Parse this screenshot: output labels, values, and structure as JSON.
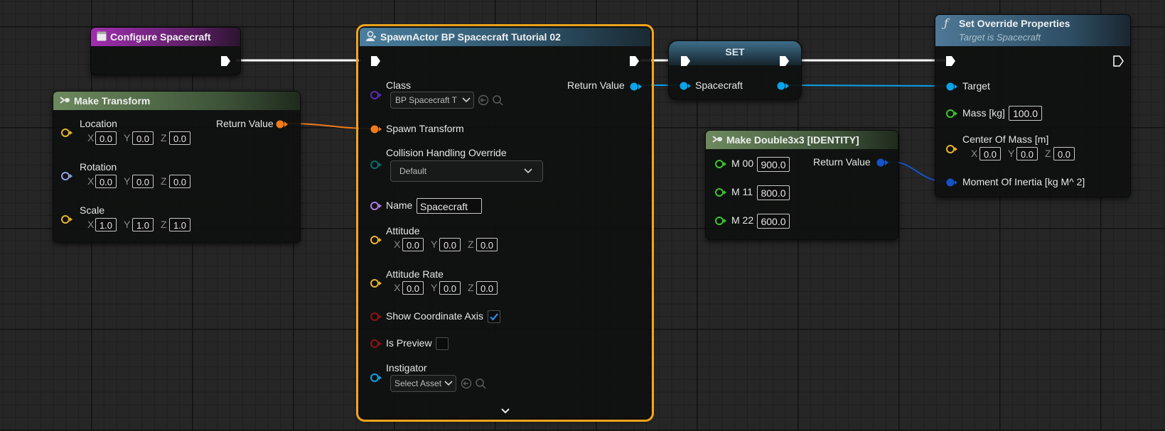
{
  "colors": {
    "exec": "#ffffff",
    "struct": "#e8b32b",
    "vector": "#8ea3e3",
    "transform": "#f07b1a",
    "object": "#0aa2e8",
    "class": "#5a2ab5",
    "enum": "#0a6a6a",
    "string": "#b07be0",
    "bool": "#8c1414",
    "double": "#3ac62c",
    "user_struct": "#1453c8",
    "selection": "#f3a41c"
  },
  "configure": {
    "title": "Configure Spacecraft"
  },
  "make_transform": {
    "title": "Make Transform",
    "return_label": "Return Value",
    "location_label": "Location",
    "rotation_label": "Rotation",
    "scale_label": "Scale",
    "axis_x": "X",
    "axis_y": "Y",
    "axis_z": "Z",
    "location": [
      "0.0",
      "0.0",
      "0.0"
    ],
    "rotation": [
      "0.0",
      "0.0",
      "0.0"
    ],
    "scale": [
      "1.0",
      "1.0",
      "1.0"
    ]
  },
  "spawn": {
    "title": "SpawnActor BP Spacecraft Tutorial 02",
    "class_label": "Class",
    "class_value": "BP Spacecraft T",
    "return_label": "Return Value",
    "spawn_transform_label": "Spawn Transform",
    "collision_label": "Collision Handling Override",
    "collision_value": "Default",
    "name_label": "Name",
    "name_value": "Spacecraft",
    "attitude_label": "Attitude",
    "attitude": [
      "0.0",
      "0.0",
      "0.0"
    ],
    "attitude_rate_label": "Attitude Rate",
    "attitude_rate": [
      "0.0",
      "0.0",
      "0.0"
    ],
    "show_axis_label": "Show Coordinate Axis",
    "show_axis_checked": true,
    "is_preview_label": "Is Preview",
    "is_preview_checked": false,
    "instigator_label": "Instigator",
    "instigator_value": "Select Asset"
  },
  "set_node": {
    "title": "SET",
    "var_label": "Spacecraft"
  },
  "matrix": {
    "title": "Make Double3x3 [IDENTITY]",
    "return_label": "Return Value",
    "m00_label": "M 00",
    "m00": "900.0",
    "m11_label": "M 11",
    "m11": "800.0",
    "m22_label": "M 22",
    "m22": "600.0"
  },
  "override": {
    "title": "Set Override Properties",
    "subtitle": "Target is Spacecraft",
    "target_label": "Target",
    "mass_label": "Mass [kg]",
    "mass": "100.0",
    "com_label": "Center Of Mass [m]",
    "com": [
      "0.0",
      "0.0",
      "0.0"
    ],
    "inertia_label": "Moment Of Inertia [kg M^ 2]"
  }
}
